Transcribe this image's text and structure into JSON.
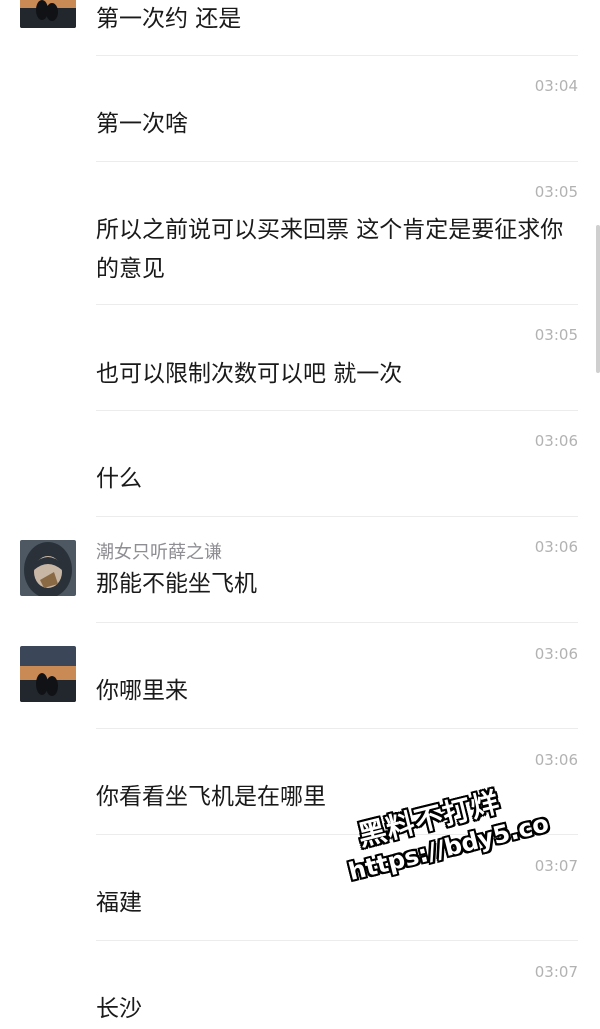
{
  "messages": [
    {
      "time": "",
      "sender": "",
      "text": "第一次约 还是"
    },
    {
      "time": "03:04",
      "sender": "",
      "text": "第一次啥"
    },
    {
      "time": "03:05",
      "sender": "",
      "text": "所以之前说可以买来回票 这个肯定是要征求你的意见"
    },
    {
      "time": "03:05",
      "sender": "",
      "text": "也可以限制次数可以吧  就一次"
    },
    {
      "time": "03:06",
      "sender": "",
      "text": "什么"
    },
    {
      "time": "03:06",
      "sender": "潮女只听薛之谦",
      "text": "那能不能坐飞机"
    },
    {
      "time": "03:06",
      "sender": "",
      "text": "你哪里来"
    },
    {
      "time": "03:06",
      "sender": "",
      "text": "你看看坐飞机是在哪里"
    },
    {
      "time": "03:07",
      "sender": "",
      "text": "福建"
    },
    {
      "time": "03:07",
      "sender": "",
      "text": "长沙"
    }
  ],
  "watermark": {
    "line1": "黑料不打烊",
    "line2": "https://bdy5.co"
  },
  "colors": {
    "text": "#1a1a1a",
    "time": "#b2b2b2",
    "sender": "#8e8e93",
    "divider": "#ececec"
  }
}
